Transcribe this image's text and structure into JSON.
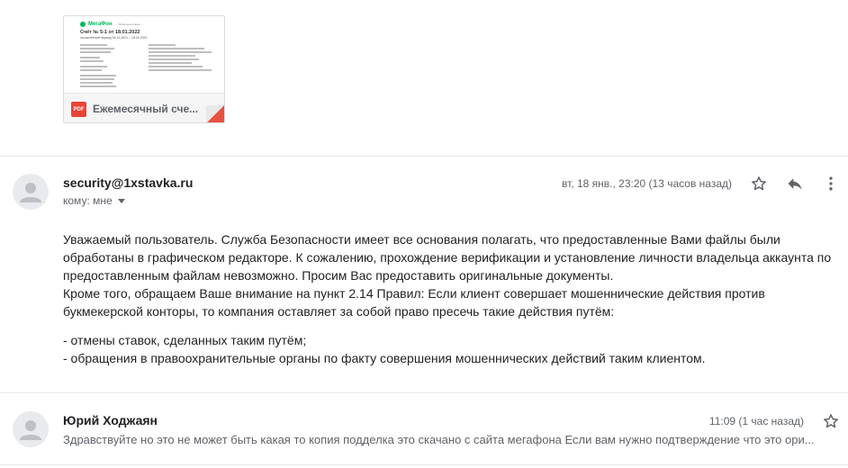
{
  "attachment": {
    "name": "Ежемесячный сче...",
    "type_badge": "PDF",
    "preview": {
      "brand": "МегаФон",
      "tagline": "Мобильная связь",
      "title": "Счёт № 5-1 от 18.01.2022",
      "subtitle": "за расчётный период 18.12.2021 – 18.01.2022"
    }
  },
  "messages": [
    {
      "sender": "security@1xstavka.ru",
      "recipients_label": "кому: мне",
      "date": "вт, 18 янв., 23:20 (13 часов назад)",
      "body": [
        "Уважаемый пользователь. Служба Безопасности имеет все основания полагать, что предоставленные Вами файлы были обработаны в графическом редакторе. К сожалению, прохождение верификации и установление личности владельца аккаунта по предоставленным файлам невозможно. Просим Вас предоставить оригинальные документы.",
        "Кроме того, обращаем Ваше внимание на пункт 2.14 Правил: Если клиент совершает мошеннические действия против букмекерской конторы, то компания оставляет за собой право пресечь такие действия путём:",
        "- отмены ставок, сделанных таким путём;",
        "- обращения в правоохранительные органы по факту совершения мошеннических действий таким клиентом."
      ]
    },
    {
      "sender": "Юрий Ходжаян",
      "date": "11:09 (1 час назад)",
      "snippet": "Здравствуйте но это не может быть какая то копия подделка это скачано с сайта мегафона Если вам нужно подтверждение что это ори..."
    }
  ],
  "icons": {
    "star": "star-icon",
    "reply": "reply-icon",
    "more": "more-vertical-icon",
    "avatar": "person-icon"
  },
  "colors": {
    "pdf_red": "#ea4335",
    "megafon_green": "#00b956",
    "muted_text": "#5f6368",
    "avatar_bg": "#e8eaed"
  }
}
